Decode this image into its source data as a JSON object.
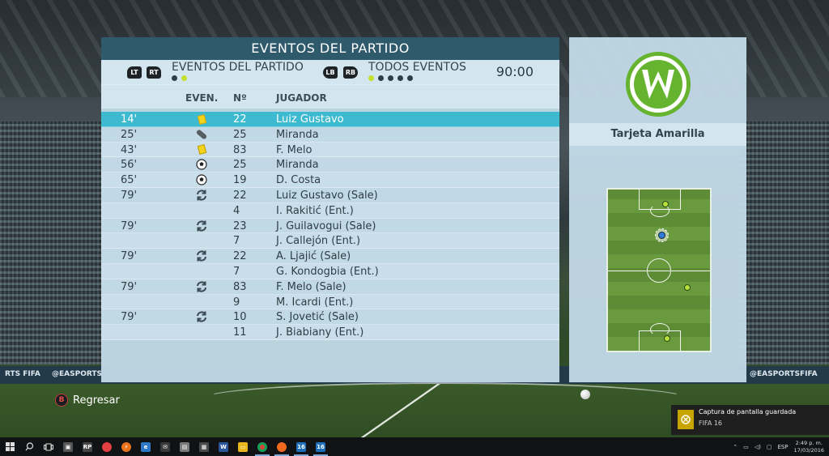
{
  "panel": {
    "title": "EVENTOS DEL PARTIDO",
    "filter1_label": "EVENTOS DEL PARTIDO",
    "filter2_label": "TODOS EVENTOS",
    "btn_lt": "LT",
    "btn_rt": "RT",
    "btn_lb": "LB",
    "btn_rb": "RB",
    "time": "90:00",
    "columns": {
      "event": "EVEN.",
      "number": "Nº",
      "player": "JUGADOR"
    }
  },
  "events": [
    {
      "minute": "14'",
      "icon": "yellow-card-icon",
      "number": "22",
      "player": "Luiz Gustavo",
      "selected": true
    },
    {
      "minute": "25'",
      "icon": "injury-icon",
      "number": "25",
      "player": "Miranda"
    },
    {
      "minute": "43'",
      "icon": "yellow-card-icon",
      "number": "83",
      "player": "F. Melo"
    },
    {
      "minute": "56'",
      "icon": "goal-ball-icon",
      "number": "25",
      "player": "Miranda"
    },
    {
      "minute": "65'",
      "icon": "goal-ball-icon",
      "number": "19",
      "player": "D. Costa"
    },
    {
      "minute": "79'",
      "icon": "substitution-icon",
      "number": "22",
      "player": "Luiz Gustavo (Sale)"
    },
    {
      "minute": "",
      "icon": "",
      "number": "4",
      "player": "I. Rakitić (Ent.)"
    },
    {
      "minute": "79'",
      "icon": "substitution-icon",
      "number": "23",
      "player": "J. Guilavogui (Sale)"
    },
    {
      "minute": "",
      "icon": "",
      "number": "7",
      "player": "J. Callejón (Ent.)"
    },
    {
      "minute": "79'",
      "icon": "substitution-icon",
      "number": "22",
      "player": "A. Ljajić (Sale)"
    },
    {
      "minute": "",
      "icon": "",
      "number": "7",
      "player": "G. Kondogbia (Ent.)"
    },
    {
      "minute": "79'",
      "icon": "substitution-icon",
      "number": "83",
      "player": "F. Melo (Sale)"
    },
    {
      "minute": "",
      "icon": "",
      "number": "9",
      "player": "M. Icardi (Ent.)"
    },
    {
      "minute": "79'",
      "icon": "substitution-icon",
      "number": "10",
      "player": "S. Jovetić (Sale)"
    },
    {
      "minute": "",
      "icon": "",
      "number": "11",
      "player": "J. Biabiany (Ent.)"
    }
  ],
  "side": {
    "crest_icon": "wolfsburg-crest-icon",
    "event_label": "Tarjeta Amarilla"
  },
  "back": {
    "button": "B",
    "label": "Regresar"
  },
  "toast": {
    "title": "Captura de pantalla guardada",
    "subtitle": "FIFA 16"
  },
  "ads": {
    "left": "RTS FIFA",
    "left2": "@EASPORTS",
    "right": "@EASPORTSFIFA"
  },
  "taskbar": {
    "items": [
      "RP",
      "16",
      "16"
    ],
    "lang": "ESP",
    "time": "2:49 p. m.",
    "date": "17/03/2016"
  },
  "colors": {
    "accent": "#3dbad0",
    "title_bar": "#2e5a6c",
    "panel_bg": "#c6deec",
    "wolfsburg_green": "#65b32e"
  }
}
